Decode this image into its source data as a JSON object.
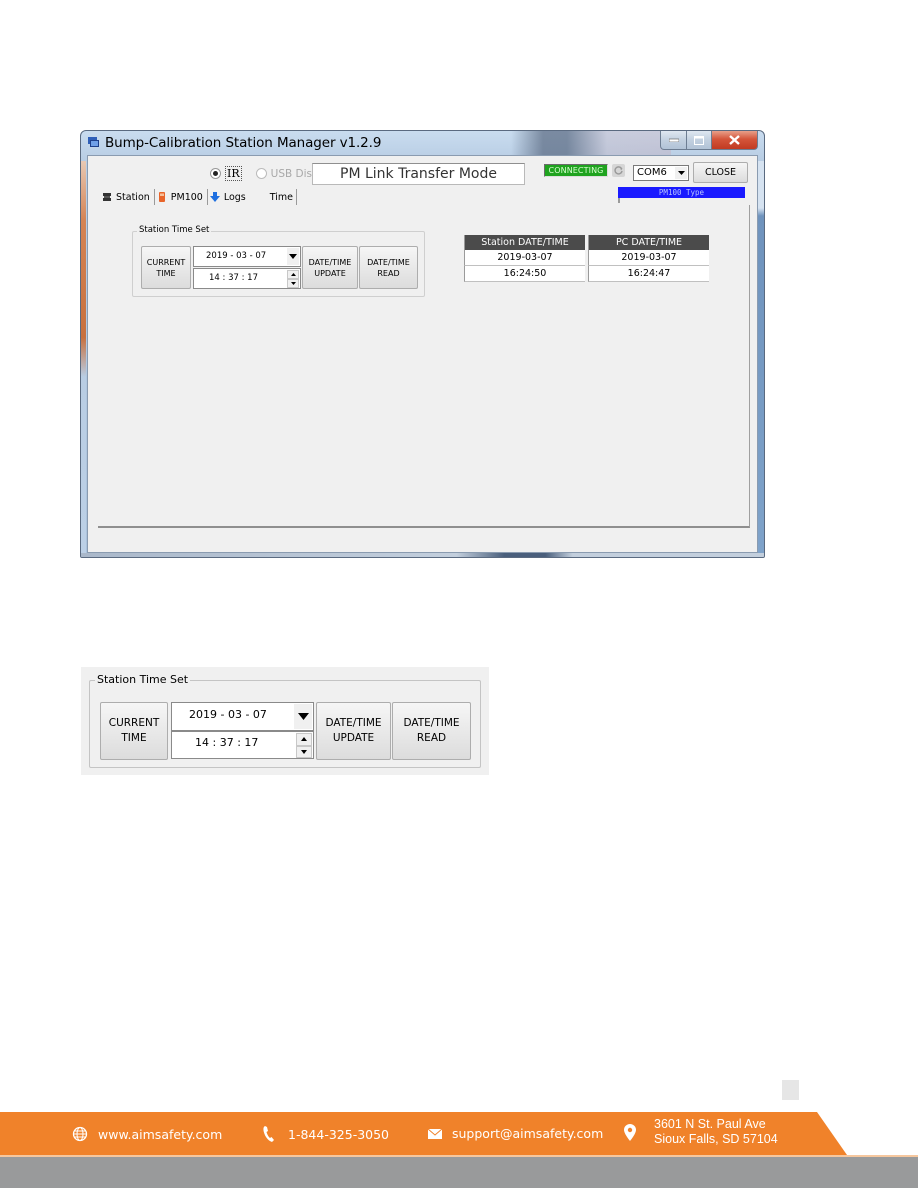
{
  "window": {
    "title": "Bump-Calibration Station Manager v1.2.9",
    "transfer": {
      "options": [
        {
          "label": "IR",
          "selected": true,
          "enabled": true
        },
        {
          "label": "USB Disk",
          "selected": false,
          "enabled": false
        }
      ],
      "mode_text": "PM Link Transfer Mode"
    },
    "connection": {
      "status": "CONNECTING",
      "status_color": "#1fa31f",
      "port": "COM6",
      "close_label": "CLOSE",
      "device_type": "PM100 Type",
      "device_type_color": "#1a1aff"
    },
    "tabs": [
      {
        "label": "Station",
        "icon": "station-icon",
        "active": false
      },
      {
        "label": "PM100",
        "icon": "pm100-device-icon",
        "active": false
      },
      {
        "label": "Logs",
        "icon": "download-arrow-icon",
        "active": false
      },
      {
        "label": "Time",
        "icon": "",
        "active": true
      }
    ],
    "time_set": {
      "group_title": "Station Time Set",
      "current_time_label": "CURRENT TIME",
      "date_value": "2019 - 03 - 07",
      "time_value": "14 : 37 : 17",
      "update_label": "DATE/TIME UPDATE",
      "read_label": "DATE/TIME READ"
    },
    "datetime_table": {
      "headers": [
        "Station DATE/TIME",
        "PC DATE/TIME"
      ],
      "rows": [
        [
          "2019-03-07",
          "2019-03-07"
        ],
        [
          "16:24:50",
          "16:24:47"
        ]
      ]
    }
  },
  "enlarged": {
    "group_title": "Station Time Set",
    "current_time_label": "CURRENT TIME",
    "date_value": "2019 - 03 - 07",
    "time_value": "14 : 37 : 17",
    "update_label": "DATE/TIME UPDATE",
    "read_label": "DATE/TIME READ"
  },
  "footer": {
    "accent_color": "#f0822a",
    "website": "www.aimsafety.com",
    "phone": "1-844-325-3050",
    "email": "support@aimsafety.com",
    "address_line1": "3601 N St. Paul Ave",
    "address_line2": "Sioux Falls, SD 57104"
  }
}
